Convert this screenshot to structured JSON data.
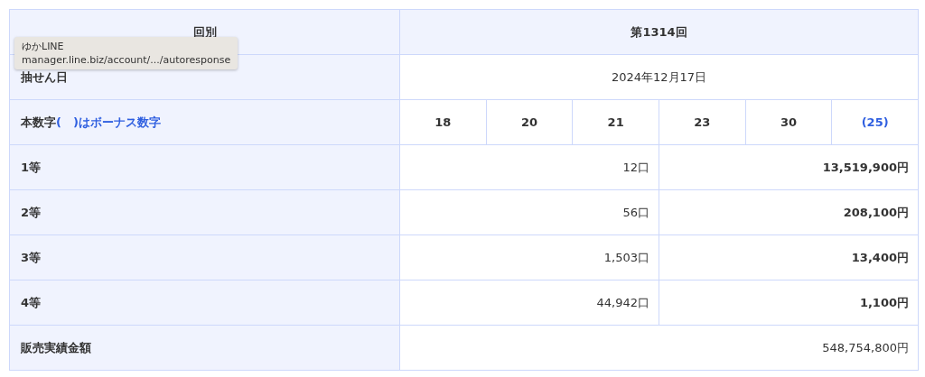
{
  "header": {
    "label": "回別",
    "value": "第1314回"
  },
  "draw_date": {
    "label": "抽せん日",
    "value": "2024年12月17日"
  },
  "numbers": {
    "label": "本数字",
    "note": "(　)はボーナス数字",
    "items": [
      {
        "value": "18",
        "bonus": false
      },
      {
        "value": "20",
        "bonus": false
      },
      {
        "value": "21",
        "bonus": false
      },
      {
        "value": "23",
        "bonus": false
      },
      {
        "value": "30",
        "bonus": false
      },
      {
        "value": "(25)",
        "bonus": true
      }
    ]
  },
  "prizes": [
    {
      "label": "1等",
      "count": "12口",
      "amount": "13,519,900円"
    },
    {
      "label": "2等",
      "count": "56口",
      "amount": "208,100円"
    },
    {
      "label": "3等",
      "count": "1,503口",
      "amount": "13,400円"
    },
    {
      "label": "4等",
      "count": "44,942口",
      "amount": "1,100円"
    }
  ],
  "sales": {
    "label": "販売実績金額",
    "value": "548,754,800円"
  },
  "tooltip": {
    "title": "ゆかLINE",
    "url": "manager.line.biz/account/.../autoresponse"
  }
}
